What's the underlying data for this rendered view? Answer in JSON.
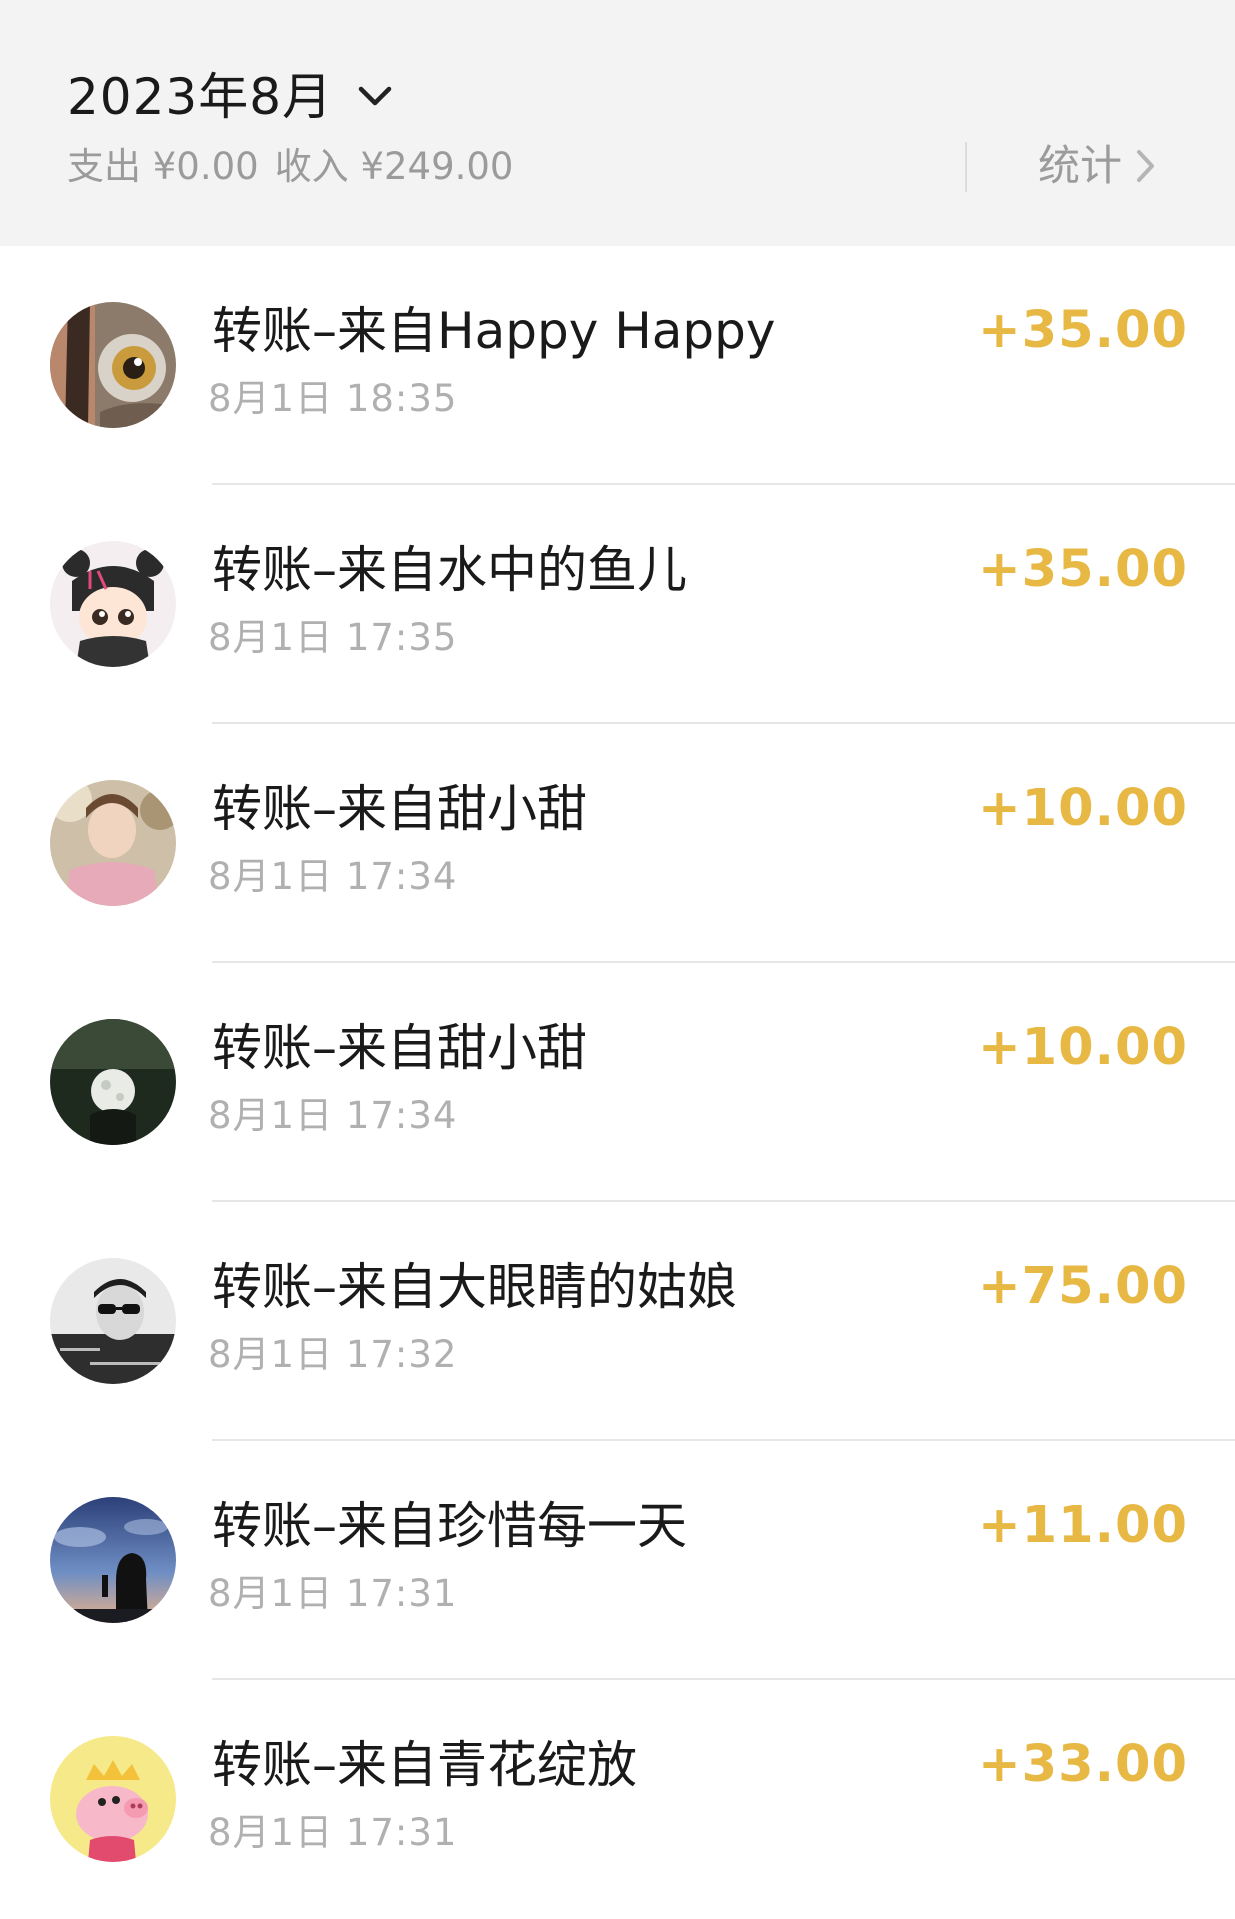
{
  "header": {
    "month": "2023年8月",
    "expense": "支出 ¥0.00",
    "income": "收入 ¥249.00",
    "stats_label": "统计"
  },
  "transactions": [
    {
      "title": "转账–来自Happy Happy",
      "time": "8月1日 18:35",
      "amount": "+35.00"
    },
    {
      "title": "转账–来自水中的鱼儿",
      "time": "8月1日 17:35",
      "amount": "+35.00"
    },
    {
      "title": "转账–来自甜小甜",
      "time": "8月1日 17:34",
      "amount": "+10.00"
    },
    {
      "title": "转账–来自甜小甜",
      "time": "8月1日 17:34",
      "amount": "+10.00"
    },
    {
      "title": "转账–来自大眼睛的姑娘",
      "time": "8月1日 17:32",
      "amount": "+75.00"
    },
    {
      "title": "转账–来自珍惜每一天",
      "time": "8月1日 17:31",
      "amount": "+11.00"
    },
    {
      "title": "转账–来自青花绽放",
      "time": "8月1日 17:31",
      "amount": "+33.00"
    }
  ],
  "colors": {
    "amount": "#e8b844",
    "header_bg": "#f3f3f3",
    "muted_text": "#9b9b9b"
  },
  "icons": [
    "chevron-down-icon",
    "chevron-right-icon"
  ]
}
